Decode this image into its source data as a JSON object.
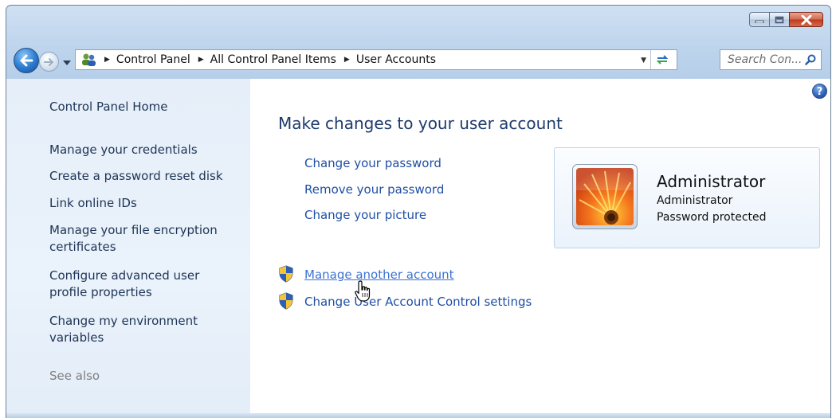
{
  "window": {
    "controls": {
      "minimize": "minimize-icon",
      "maximize": "maximize-icon",
      "close": "close-icon"
    }
  },
  "address_bar": {
    "breadcrumbs": [
      {
        "label": "Control Panel"
      },
      {
        "label": "All Control Panel Items"
      },
      {
        "label": "User Accounts"
      }
    ],
    "search_placeholder": "Search Con..."
  },
  "sidebar": {
    "home": "Control Panel Home",
    "tasks": [
      {
        "label": "Manage your credentials"
      },
      {
        "label": "Create a password reset disk"
      },
      {
        "label": "Link online IDs"
      },
      {
        "label": "Manage your file encryption certificates"
      },
      {
        "label": "Configure advanced user profile properties"
      },
      {
        "label": "Change my environment variables"
      }
    ],
    "see_also": "See also"
  },
  "main": {
    "help": "?",
    "title": "Make changes to your user account",
    "links": [
      {
        "label": "Change your password"
      },
      {
        "label": "Remove your password"
      },
      {
        "label": "Change your picture"
      }
    ],
    "admin_links": [
      {
        "label": "Manage another account"
      },
      {
        "label": "Change User Account Control settings"
      }
    ],
    "user": {
      "name": "Administrator",
      "type": "Administrator",
      "status": "Password protected"
    }
  },
  "colors": {
    "link": "#1f4fa6",
    "title": "#1e3a6d",
    "sidebar_bg": "#e6eff9"
  }
}
